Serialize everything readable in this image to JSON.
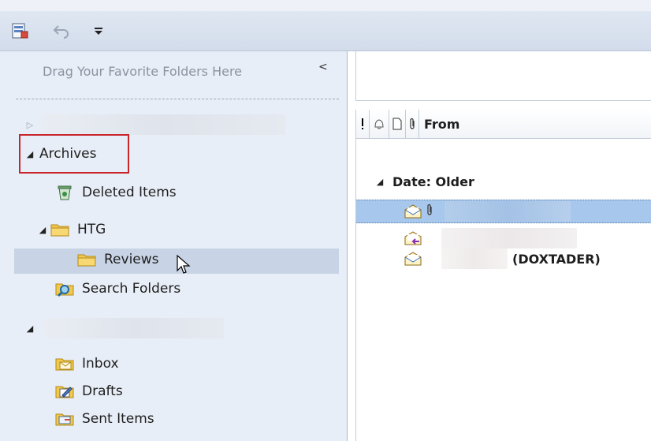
{
  "quick_access": {
    "save_icon": "save-icon",
    "undo_icon": "undo-icon",
    "customize_icon": "qat-customize-icon"
  },
  "nav": {
    "favorites_hint": "Drag Your Favorite Folders Here",
    "collapse_glyph": "<",
    "archives_label": "Archives",
    "deleted_items": "Deleted Items",
    "htg": "HTG",
    "reviews": "Reviews",
    "search_folders": "Search Folders",
    "inbox": "Inbox",
    "drafts": "Drafts",
    "sent_items": "Sent Items"
  },
  "messages": {
    "column_from": "From",
    "group_label": "Date: Older",
    "rows": [
      {
        "icon": "envelope-open-icon",
        "sender": ""
      },
      {
        "icon": "envelope-reply-icon",
        "sender": ""
      },
      {
        "icon": "envelope-open-icon",
        "sender": "(DOXTADER)"
      }
    ]
  },
  "colors": {
    "nav_bg": "#e8eef7",
    "selected_row": "#c8d4e5",
    "selected_mail": "#a7c7ec",
    "highlight_box": "#c8262b"
  }
}
